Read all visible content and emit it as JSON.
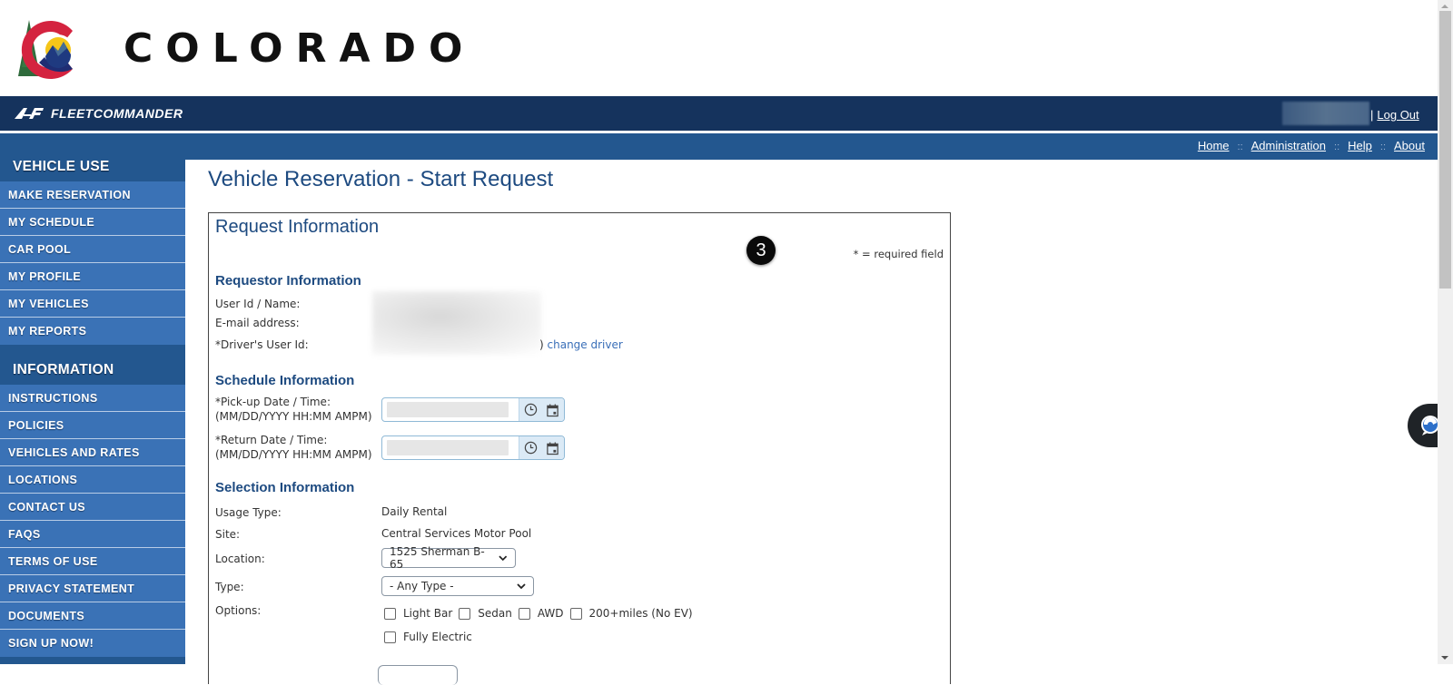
{
  "branding": {
    "state_name": "COLORADO",
    "app_name": "FLEETCOMMANDER"
  },
  "topbar": {
    "separator": "|",
    "logout_label": "Log Out"
  },
  "nav": {
    "links": [
      "Home",
      "Administration",
      "Help",
      "About"
    ],
    "separator": "::"
  },
  "sidebar": {
    "sections": [
      {
        "heading": "VEHICLE USE",
        "items": [
          "MAKE RESERVATION",
          "MY SCHEDULE",
          "CAR POOL",
          "MY PROFILE",
          "MY VEHICLES",
          "MY REPORTS"
        ]
      },
      {
        "heading": "INFORMATION",
        "items": [
          "INSTRUCTIONS",
          "POLICIES",
          "VEHICLES AND RATES",
          "LOCATIONS",
          "CONTACT US",
          "FAQS",
          "TERMS OF USE",
          "PRIVACY STATEMENT",
          "DOCUMENTS",
          "SIGN UP NOW!"
        ]
      }
    ]
  },
  "main": {
    "page_title": "Vehicle Reservation - Start Request",
    "panel_title": "Request Information",
    "required_note": "* = required field",
    "step_badge": "3",
    "requestor": {
      "title": "Requestor Information",
      "user_id_label": "User Id / Name:",
      "email_label": "E-mail address:",
      "driver_label": "*Driver's User Id:",
      "change_driver_prefix": ")",
      "change_driver_label": "change driver"
    },
    "schedule": {
      "title": "Schedule Information",
      "pickup_label": "*Pick-up Date / Time:",
      "return_label": "*Return Date / Time:",
      "format_hint": "(MM/DD/YYYY HH:MM AMPM)"
    },
    "selection": {
      "title": "Selection Information",
      "usage_type_label": "Usage Type:",
      "usage_type_value": "Daily Rental",
      "site_label": "Site:",
      "site_value": "Central Services Motor Pool",
      "location_label": "Location:",
      "location_value": "1525 Sherman B-65",
      "type_label": "Type:",
      "type_value": "- Any Type -",
      "options_label": "Options:",
      "options": [
        {
          "label": "Light Bar",
          "checked": false
        },
        {
          "label": "Sedan",
          "checked": false
        },
        {
          "label": "AWD",
          "checked": false
        },
        {
          "label": "200+miles (No EV)",
          "checked": false
        },
        {
          "label": "Fully Electric",
          "checked": false
        }
      ]
    }
  },
  "colors": {
    "topbar": "#15335d",
    "navbar": "#23578f",
    "sidebar_item": "#3a72b6",
    "heading": "#1d4a80",
    "link": "#3a6fb8"
  }
}
